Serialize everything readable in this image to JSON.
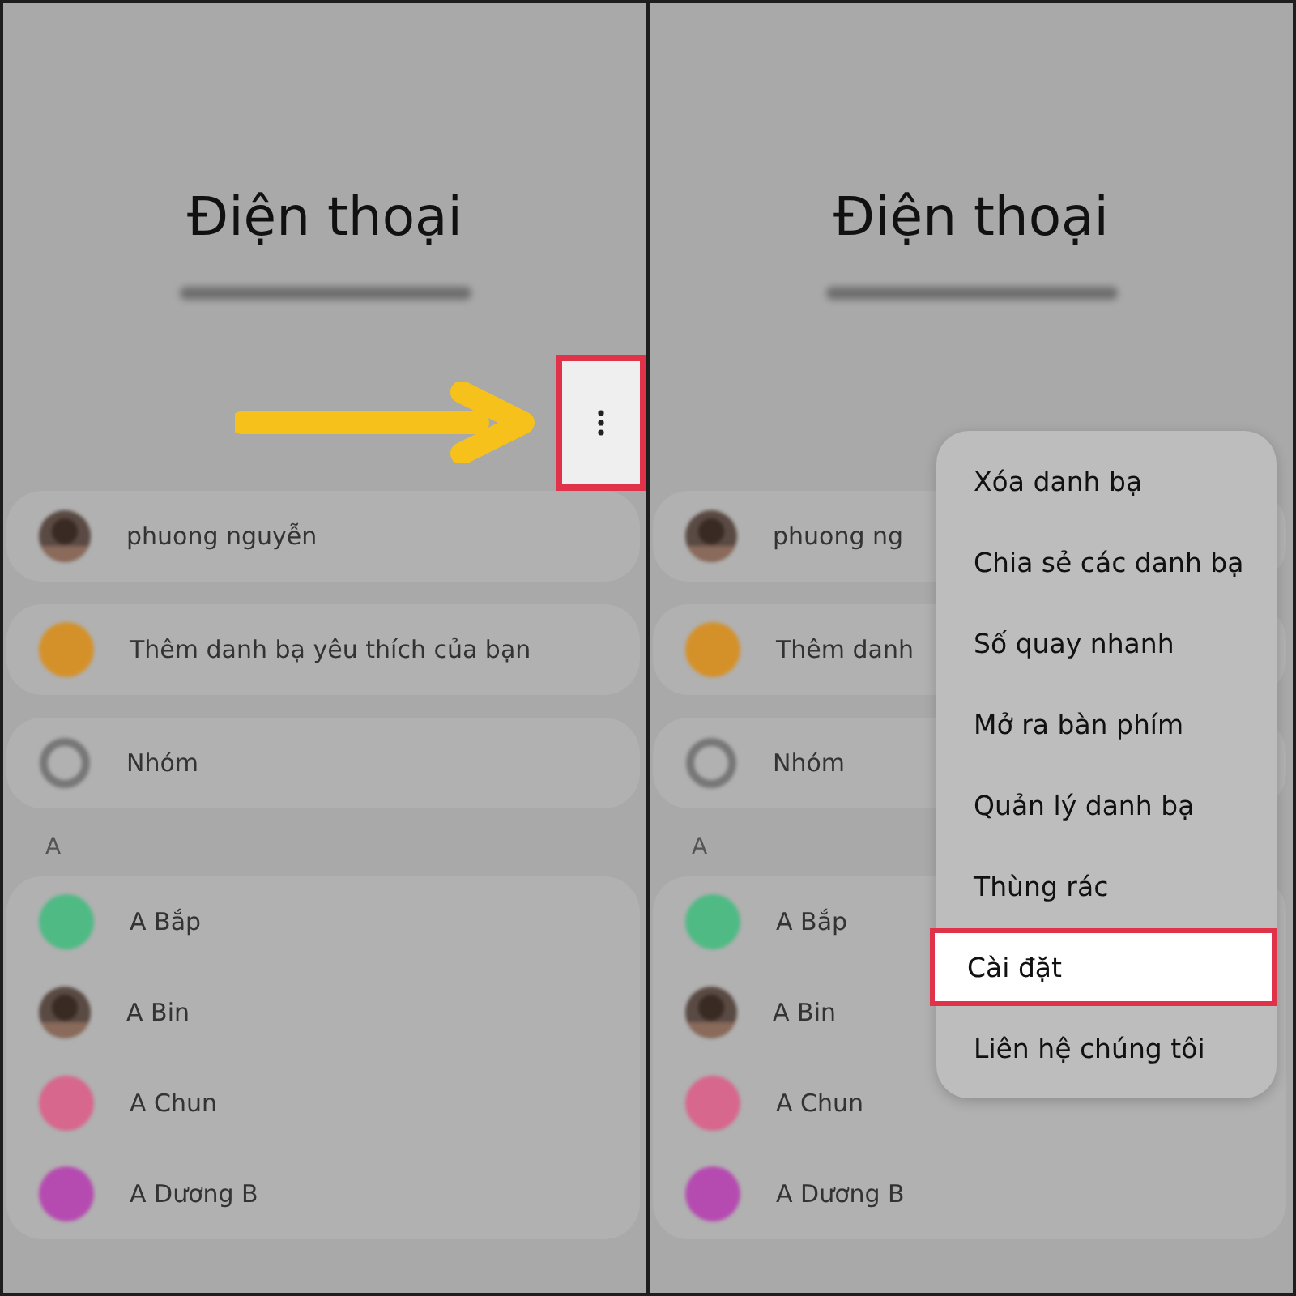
{
  "panels": [
    {
      "title": "Điện thoại",
      "more_button": {
        "highlighted": true,
        "pointer_arrow": true
      },
      "groups": [
        {
          "kind": "card",
          "rows": [
            {
              "name": "phuong nguyễn"
            }
          ]
        },
        {
          "kind": "card",
          "rows": [
            {
              "name": "Thêm danh bạ yêu thích của bạn",
              "kind": "color",
              "color": "#d4912a"
            }
          ]
        },
        {
          "kind": "card",
          "rows": [
            {
              "name": "Nhóm",
              "kind": "ring"
            }
          ]
        },
        {
          "kind": "header",
          "label": "A"
        },
        {
          "kind": "card",
          "rows": [
            {
              "name": "A Bắp",
              "kind": "color",
              "color": "#4fba84"
            },
            {
              "name": "A Bin"
            },
            {
              "name": "A Chun",
              "kind": "color",
              "color": "#d7678c"
            },
            {
              "name": "A Dương B",
              "kind": "color",
              "color": "#b54bb0"
            }
          ]
        }
      ]
    },
    {
      "title": "Điện thoại",
      "groups": [
        {
          "kind": "card",
          "rows": [
            {
              "name": "phuong ng"
            }
          ]
        },
        {
          "kind": "card",
          "rows": [
            {
              "name": "Thêm danh",
              "kind": "color",
              "color": "#d4912a"
            }
          ]
        },
        {
          "kind": "card",
          "rows": [
            {
              "name": "Nhóm",
              "kind": "ring"
            }
          ]
        },
        {
          "kind": "header",
          "label": "A"
        },
        {
          "kind": "card",
          "rows": [
            {
              "name": "A Bắp",
              "kind": "color",
              "color": "#4fba84"
            },
            {
              "name": "A Bin"
            },
            {
              "name": "A Chun",
              "kind": "color",
              "color": "#d7678c"
            },
            {
              "name": "A Dương B",
              "kind": "color",
              "color": "#b54bb0"
            }
          ]
        }
      ],
      "menu": {
        "items": [
          {
            "label": "Xóa danh bạ",
            "selected": false
          },
          {
            "label": "Chia sẻ các danh bạ",
            "selected": false
          },
          {
            "label": "Số quay nhanh",
            "selected": false
          },
          {
            "label": "Mở ra bàn phím",
            "selected": false
          },
          {
            "label": "Quản lý danh bạ",
            "selected": false
          },
          {
            "label": "Thùng rác",
            "selected": false
          },
          {
            "label": "Cài đặt",
            "selected": true
          },
          {
            "label": "Liên hệ chúng tôi",
            "selected": false
          }
        ]
      }
    }
  ]
}
